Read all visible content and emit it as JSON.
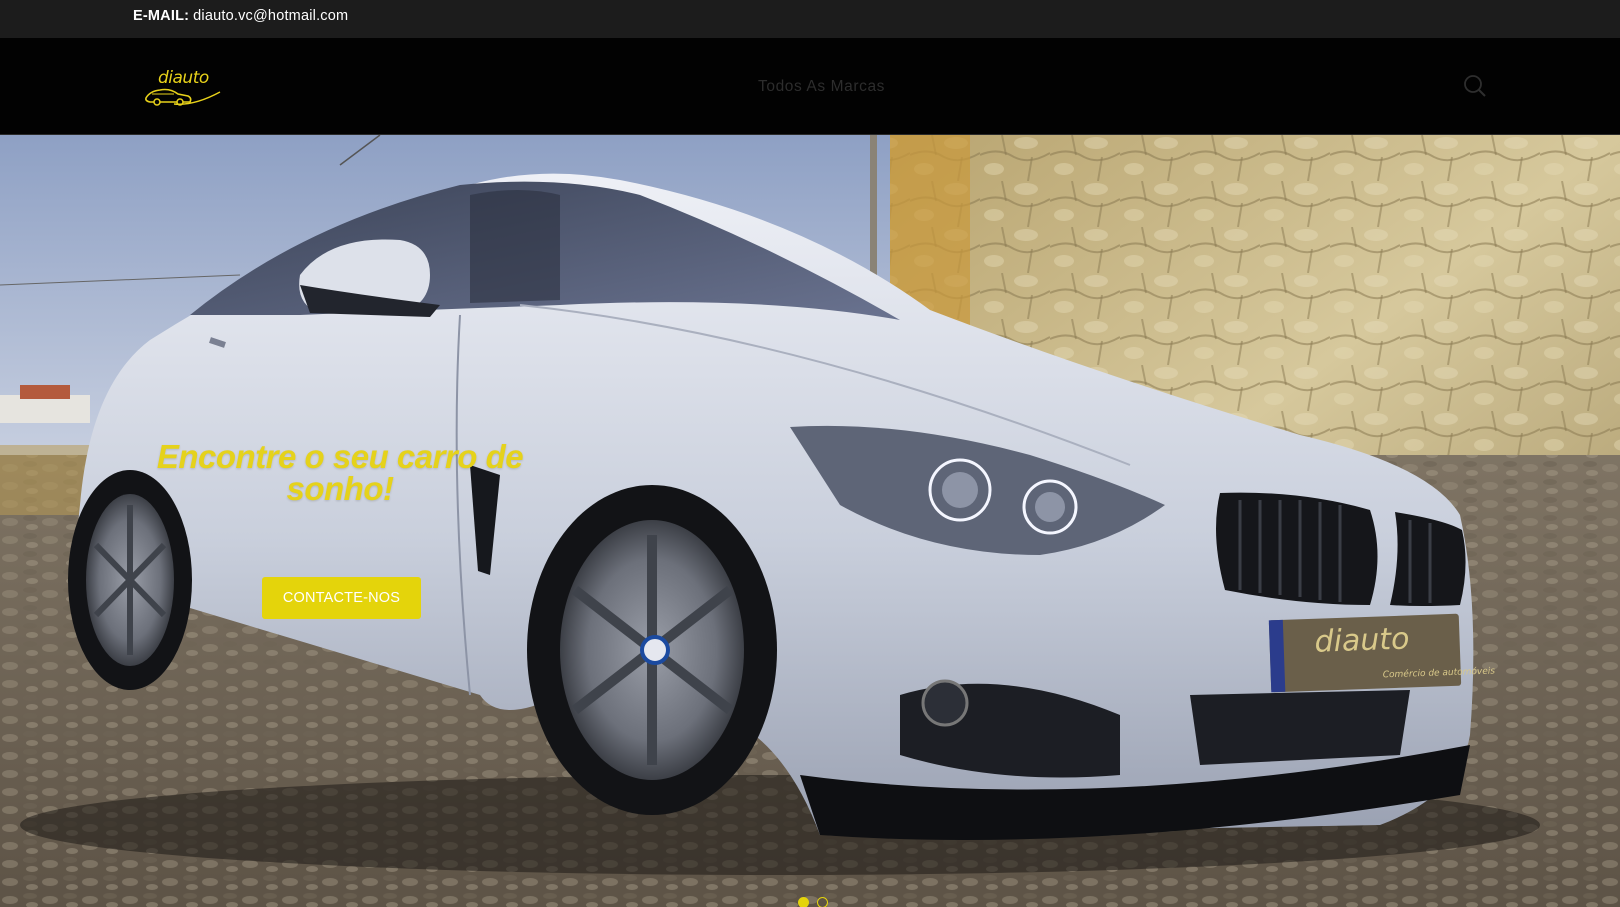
{
  "topbar": {
    "email_label": "E-MAIL:",
    "email_value": "diauto.vc@hotmail.com"
  },
  "header": {
    "logo_text": "diauto",
    "nav": [
      {
        "label": "Todos As Marcas"
      }
    ],
    "search_icon": "search-icon"
  },
  "hero": {
    "headline": "Encontre o seu carro de sonho!",
    "cta_label": "CONTACTE-NOS",
    "plate_logo": "diauto",
    "plate_tagline": "Comércio de automóveis",
    "slides": {
      "count": 2,
      "active": 1
    }
  },
  "colors": {
    "accent": "#e4d40b",
    "topbar": "#1c1c1c",
    "header": "#020202"
  }
}
